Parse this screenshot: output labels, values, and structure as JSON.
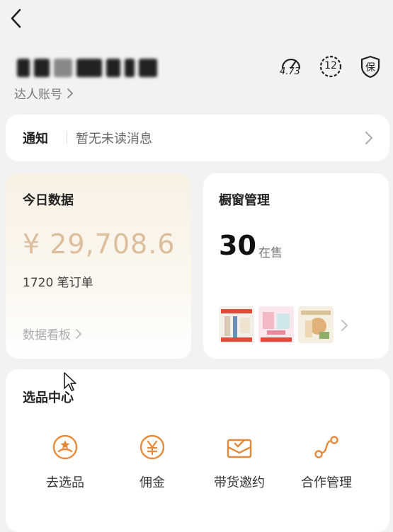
{
  "header": {
    "account_link_label": "达人账号",
    "badges": [
      {
        "icon": "speedometer-icon",
        "label": "4.73"
      },
      {
        "icon": "level-badge-icon",
        "label": "12"
      },
      {
        "icon": "shield-icon",
        "label": "保"
      }
    ]
  },
  "notice": {
    "title": "通知",
    "message": "暂无未读消息"
  },
  "today": {
    "title": "今日数据",
    "amount": "¥ 29,708.6",
    "orders": "1720 笔订单",
    "dashboard_link": "数据看板"
  },
  "window": {
    "title": "橱窗管理",
    "count": "30",
    "count_unit": "在售"
  },
  "selection_center": {
    "title": "选品中心",
    "tools": [
      {
        "label": "去选品",
        "icon": "select-product-icon"
      },
      {
        "label": "佣金",
        "icon": "commission-icon"
      },
      {
        "label": "带货邀约",
        "icon": "invitation-icon"
      },
      {
        "label": "合作管理",
        "icon": "cooperation-icon"
      }
    ]
  },
  "colors": {
    "accent": "#e8893a",
    "amount": "#c79b6a",
    "background": "#f2f2f2"
  }
}
